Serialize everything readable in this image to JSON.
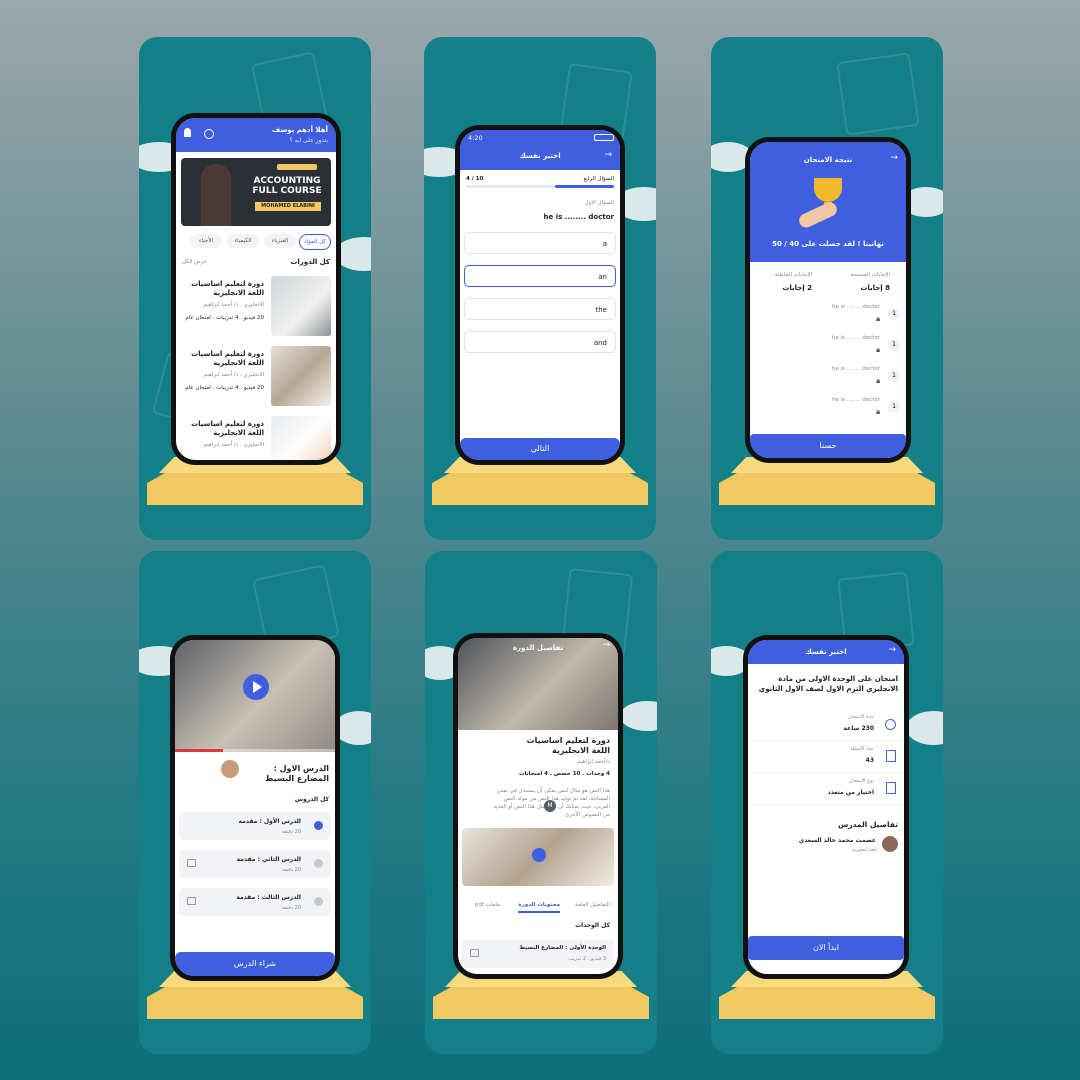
{
  "colors": {
    "brand": "#3f5fe0",
    "teal": "#137f86",
    "gold": "#f2c863"
  },
  "s1": {
    "greeting": "أهلا أدهم يوسف",
    "sub": "بتدور على ايه ؟",
    "banner_title": "ACCOUNTING FULL COURSE",
    "banner_name": "MOHAMED ELABINI",
    "chips": [
      "كل المواد",
      "الفيزياء",
      "الكيمياء",
      "الأحياء"
    ],
    "section": "كل الدورات",
    "show_all": "عرض الكل",
    "courses": [
      {
        "title": "دورة لتعليم اساسيات اللغة الانجليزية",
        "teacher": "الانجليزي . د/ أحمد ابراهيم",
        "meta": "20 فيديو . 4 تدريبات . امتحان عام"
      },
      {
        "title": "دورة لتعليم اساسيات اللغة الانجليزية",
        "teacher": "الانجليزي . د/ أحمد ابراهيم",
        "meta": "20 فيديو . 4 تدريبات . امتحان عام"
      },
      {
        "title": "دورة لتعليم اساسيات اللغة الانجليزية",
        "teacher": "الانجليزي . د/ أحمد ابراهيم"
      }
    ]
  },
  "s2": {
    "time": "4:20",
    "title": "اختبر نفسك",
    "q_no": "السؤال الرابع",
    "progress": "4 / 10",
    "progress_value": 0.4,
    "q_label": "السؤال الاول",
    "question": "he is ........ doctor",
    "options": [
      "a",
      "an",
      "the",
      "and"
    ],
    "selected": 1,
    "next": "التالي"
  },
  "s3": {
    "title": "نتيجة الامتحان",
    "congrats": "تهانينا ! لقد حصلت على 40 / 50",
    "correct_label": "الإجابات الصحيحة",
    "correct_value": "8 إجابات",
    "wrong_label": "الإجابات الخاطئة",
    "wrong_value": "2 إجابات",
    "answers": [
      {
        "n": "1",
        "q": "he is ........ doctor",
        "a": "a"
      },
      {
        "n": "1",
        "q": "he is ........ doctor",
        "a": "a"
      },
      {
        "n": "1",
        "q": "he is ........ doctor",
        "a": "a"
      },
      {
        "n": "1",
        "q": "he is ........ doctor",
        "a": "a"
      }
    ],
    "ok": "حسنا"
  },
  "s4": {
    "lesson_title": "الدرس الاول : المضارع البسيط",
    "all_lessons": "كل الدروس",
    "video_progress": 0.3,
    "lessons": [
      {
        "title": "الدرس الأول : مقدمة",
        "dur": "20 دقيقة"
      },
      {
        "title": "الدرس الثاني : مقدمة",
        "dur": "20 دقيقة"
      },
      {
        "title": "الدرس الثالث : مقدمة",
        "dur": "20 دقيقة"
      }
    ],
    "buy": "شراء الدرس"
  },
  "s5": {
    "header": "تفاصيل الدورة",
    "title": "دورة لتعليم اساسيات اللغة الانجليزية",
    "teacher": "د/أحمد ابراهيم",
    "meta": "4 وحدات . 10 حصص . 4 امتحانات",
    "desc1": "هذا النص هو مثال لنص يمكن أن يستبدل في نفس",
    "desc2": "المساحة، لقد تم توليد هذا النص من مولد النص",
    "desc3": "العربى، حيث يمكنك أن تولد مثل هذا النص أو العديد",
    "desc4": "من النصوص الأخرى",
    "avatar_letter": "M",
    "tabs": [
      "التفاصيل العامة",
      "محتويات الدورة",
      "ملفات pdf"
    ],
    "active_tab": 1,
    "units": "كل الوحدات",
    "unit_title": "الوحدة الأولى : المضارع البسيط",
    "unit_meta": "3 فيديو . 2 تدريب"
  },
  "s6": {
    "title": "اختبر نفسك",
    "exam_title": "امتحان على الوحدة الاولى من مادة الانجليزي الترم الاول لصف الاول الثانوي",
    "rows": [
      {
        "label": "مدة الامتحان",
        "value": "230 ساعة"
      },
      {
        "label": "عدد الاسئلة",
        "value": "43"
      },
      {
        "label": "نوع الامتحان",
        "value": "اختيار من متعدد"
      }
    ],
    "teacher_section": "تفاصيل المدرس",
    "teacher_name": "عصمت محمد خالد السعدي",
    "teacher_sub": "لغة انجليزية",
    "start": "ابدأ الان"
  }
}
